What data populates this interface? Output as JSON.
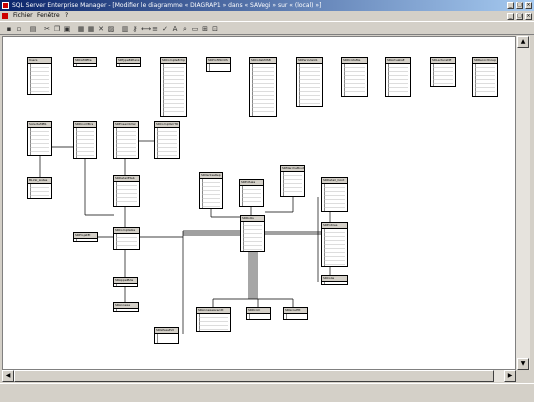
{
  "window": {
    "title": "SQL Server Enterprise Manager - [Modifier le diagramme « DIAGRAP1 » dans « SAVegi » sur « (local) »]",
    "minimize_glyph": "_",
    "maximize_glyph": "□",
    "close_glyph": "×"
  },
  "menu": {
    "items": [
      "Fichier",
      "Fenêtre",
      "?"
    ]
  },
  "toolbar": {
    "icons": [
      "save-icon",
      "print-icon",
      "print-setup-icon",
      "cut-icon",
      "copy-icon",
      "paste-icon",
      "new-table-icon",
      "add-table-icon",
      "delete-table-icon",
      "remove-table-icon",
      "properties-icon",
      "key-icon",
      "relationship-icon",
      "indexes-icon",
      "check-icon",
      "new-text-icon",
      "zoom-icon",
      "page-break-icon",
      "layout-icon",
      "autosize-icon"
    ]
  },
  "diagram": {
    "tables": [
      {
        "name": "Users"
      },
      {
        "name": "SRCAMPtte"
      },
      {
        "name": "SRTypeBiPlans"
      },
      {
        "name": "SRCompteEchp"
      },
      {
        "name": "SRProfilSOUS"
      },
      {
        "name": "SRCollabMSB"
      },
      {
        "name": "SRPeriodeGS"
      },
      {
        "name": "SRDroitsMe"
      },
      {
        "name": "SRActualisE"
      },
      {
        "name": "SRLectureDE"
      },
      {
        "name": "SRRecordCoup"
      },
      {
        "name": "SAlerteMBS"
      },
      {
        "name": "SRDnoiVBcs"
      },
      {
        "name": "SREnsembVal"
      },
      {
        "name": "SRComptGCTR"
      },
      {
        "name": "BLink_Listes"
      },
      {
        "name": "SRDetailEtab"
      },
      {
        "name": "SRVentesRep"
      },
      {
        "name": "SREdSala"
      },
      {
        "name": "SRMarcheBoute"
      },
      {
        "name": "SRDetail_Cont"
      },
      {
        "name": "SRProjetEl"
      },
      {
        "name": "SRComptable"
      },
      {
        "name": "SRRollis"
      },
      {
        "name": "SREntries"
      },
      {
        "name": "SRAppelBde"
      },
      {
        "name": "SRColie"
      },
      {
        "name": "SRAnnexe"
      },
      {
        "name": "SRAnnexeAvecXt"
      },
      {
        "name": "SRDroiC"
      },
      {
        "name": "SRGrouEtt"
      },
      {
        "name": "SRGPessExt"
      }
    ]
  }
}
